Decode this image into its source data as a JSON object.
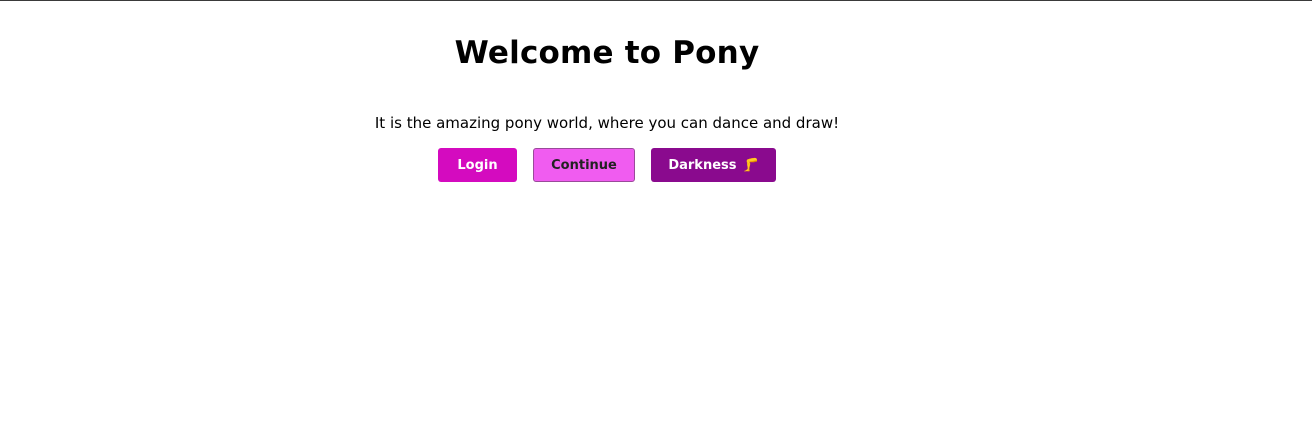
{
  "page": {
    "title": "Welcome to Pony",
    "subtitle": "It is the amazing pony world, where you can dance and draw!"
  },
  "buttons": {
    "login_label": "Login",
    "continue_label": "Continue",
    "darkness_label": "Darkness",
    "darkness_emoji": "🦵"
  },
  "colors": {
    "login": "#d40bbf",
    "continue": "#f05cf0",
    "darkness": "#8a0a8e"
  }
}
